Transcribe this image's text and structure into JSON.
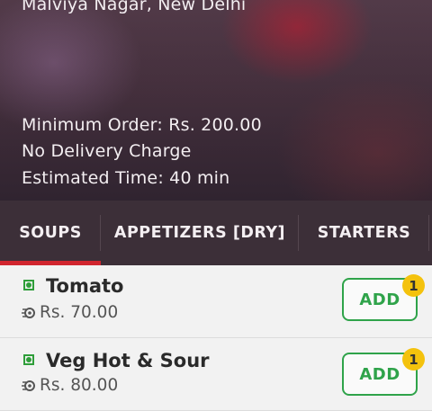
{
  "restaurant": {
    "location": "Malviya Nagar, New Delhi",
    "minimum_order": "Minimum Order: Rs. 200.00",
    "delivery": "No Delivery Charge",
    "estimated_time": "Estimated Time: 40 min"
  },
  "tabs": [
    {
      "label": "SOUPS",
      "active": true
    },
    {
      "label": "APPETIZERS [DRY]",
      "active": false
    },
    {
      "label": "STARTERS",
      "active": false
    }
  ],
  "items": [
    {
      "name": "Tomato",
      "price": "Rs. 70.00",
      "add_label": "ADD",
      "count": "1",
      "veg": true
    },
    {
      "name": "Veg Hot & Sour",
      "price": "Rs. 80.00",
      "add_label": "ADD",
      "count": "1",
      "veg": true
    }
  ],
  "colors": {
    "accent_red": "#d0252e",
    "veg_green": "#2f9e3a",
    "add_green": "#2fa34a",
    "badge_yellow": "#f4c20d",
    "tab_bar": "#3c2f38"
  }
}
